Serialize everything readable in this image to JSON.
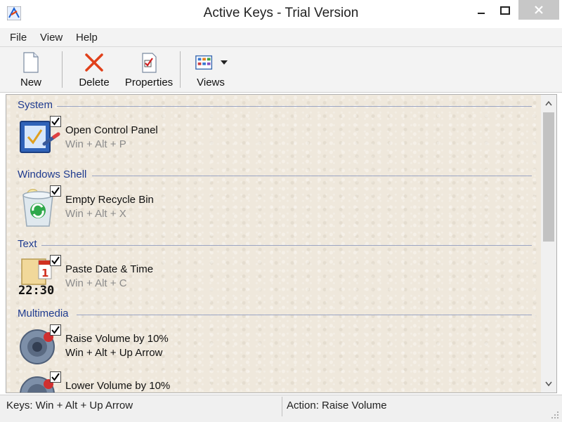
{
  "window": {
    "title": "Active Keys - Trial Version",
    "icon": "app-icon"
  },
  "menu": {
    "items": [
      "File",
      "View",
      "Help"
    ]
  },
  "toolbar": {
    "new_label": "New",
    "delete_label": "Delete",
    "properties_label": "Properties",
    "views_label": "Views"
  },
  "groups": [
    {
      "title": "System",
      "items": [
        {
          "name": "Open Control Panel",
          "keys": "Win + Alt + P",
          "checked": true,
          "icon": "control-panel-icon"
        }
      ]
    },
    {
      "title": "Windows Shell",
      "items": [
        {
          "name": "Empty Recycle Bin",
          "keys": "Win + Alt + X",
          "checked": true,
          "icon": "recycle-bin-icon"
        }
      ]
    },
    {
      "title": "Text",
      "items": [
        {
          "name": "Paste Date & Time",
          "keys": "Win + Alt + C",
          "checked": true,
          "icon": "date-time-icon"
        }
      ]
    },
    {
      "title": "Multimedia",
      "items": [
        {
          "name": "Raise Volume by 10%",
          "keys": "Win + Alt + Up Arrow",
          "checked": true,
          "icon": "volume-up-icon",
          "selected": true
        },
        {
          "name": "Lower Volume by 10%",
          "keys": "",
          "checked": true,
          "icon": "volume-down-icon"
        }
      ]
    }
  ],
  "status": {
    "keys": "Keys: Win + Alt + Up Arrow",
    "action": "Action: Raise Volume"
  },
  "colors": {
    "group_title": "#1f3b8f",
    "background": "#efe8dc",
    "secondary_text": "#8b8b8b"
  }
}
